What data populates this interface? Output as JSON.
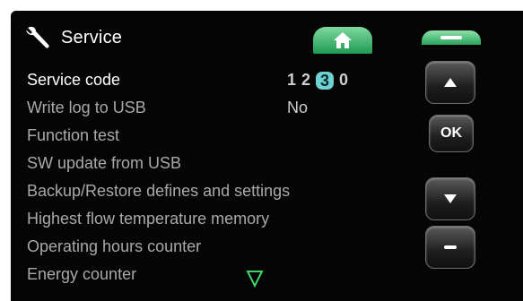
{
  "header": {
    "title": "Service",
    "icon": "wrench-icon"
  },
  "nav": {
    "home_icon": "home-icon",
    "back_icon": "back-icon"
  },
  "menu": {
    "items": [
      {
        "label": "Service code",
        "selected": true
      },
      {
        "label": "Write log to USB",
        "value": "No"
      },
      {
        "label": "Function test"
      },
      {
        "label": "SW update from USB"
      },
      {
        "label": "Backup/Restore defines and settings"
      },
      {
        "label": "Highest flow temperature memory"
      },
      {
        "label": "Operating hours counter"
      },
      {
        "label": "Energy counter"
      }
    ],
    "service_code_digits": [
      "1",
      "2",
      "3",
      "0"
    ],
    "active_digit_index": 2
  },
  "controls": {
    "up_icon": "up-arrow-icon",
    "ok_label": "OK",
    "down_icon": "down-arrow-icon",
    "minus_icon": "minus-icon"
  },
  "colors": {
    "accent_green": "#2aa55c",
    "active_digit": "#6fd1d1",
    "background": "#050505"
  },
  "scroll_indicator_icon": "scroll-down-triangle-icon"
}
